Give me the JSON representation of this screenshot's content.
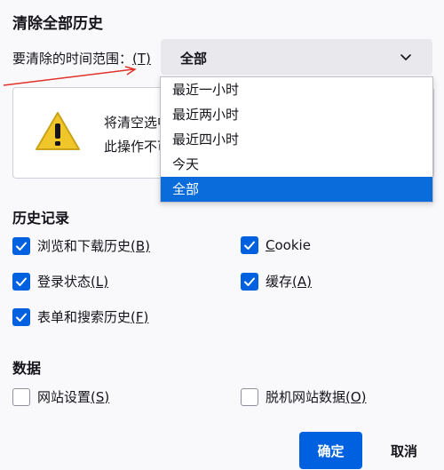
{
  "dialog": {
    "title": "清除全部历史"
  },
  "range": {
    "label": "要清除的时间范围：",
    "accesskey": "(T)",
    "selected": "全部",
    "options": [
      "最近一小时",
      "最近两小时",
      "最近四小时",
      "今天",
      "全部"
    ]
  },
  "warning": {
    "icon": "warning-triangle-icon",
    "line1": "将清空选中",
    "line2": "此操作不可"
  },
  "history": {
    "heading": "历史记录",
    "items": [
      {
        "label": "浏览和下载历史",
        "key": "(B)",
        "checked": true
      },
      {
        "label": "登录状态",
        "key": "(L)",
        "checked": true
      },
      {
        "label": "表单和搜索历史",
        "key": "(F)",
        "checked": true
      },
      {
        "label_pre": "",
        "label_key": "C",
        "label_post": "ookie",
        "checked": true
      },
      {
        "label": "缓存",
        "key": "(A)",
        "checked": true
      }
    ]
  },
  "data": {
    "heading": "数据",
    "items": [
      {
        "label": "网站设置",
        "key": "(S)",
        "checked": false
      },
      {
        "label": "脱机网站数据",
        "key": "(O)",
        "checked": false
      }
    ]
  },
  "buttons": {
    "confirm": "确定",
    "cancel": "取消"
  },
  "colors": {
    "accent": "#0061e0",
    "selected_option": "#0a6cdb",
    "annotation_arrow": "#e0322b"
  }
}
